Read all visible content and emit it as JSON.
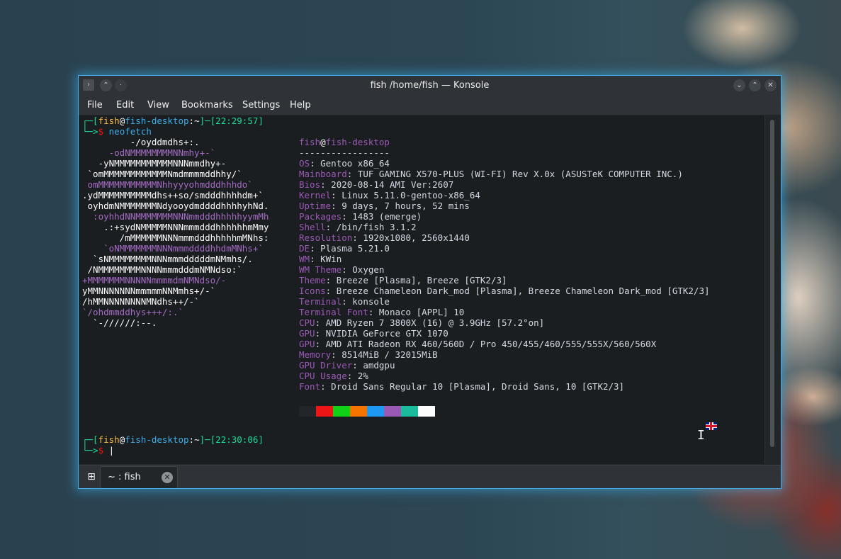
{
  "window": {
    "title": "fish /home/fish — Konsole",
    "buttons": {
      "minimize": "⌄",
      "maximize": "⌃",
      "close": "✕"
    }
  },
  "menu": [
    "File",
    "Edit",
    "View",
    "Bookmarks",
    "Settings",
    "Help"
  ],
  "tab": {
    "label": "~ : fish"
  },
  "colors": {
    "accent": "#3daee9",
    "prompt_green": "#1cdc9a",
    "purple": "#9b59b6"
  },
  "prompt1": {
    "user": "fish",
    "at": "@",
    "host": "fish-desktop",
    "dir": "~",
    "time": "22:29:57",
    "command": "neofetch"
  },
  "prompt2": {
    "user": "fish",
    "at": "@",
    "host": "fish-desktop",
    "dir": "~",
    "time": "22:30:06"
  },
  "logo": [
    "         -/oyddmdhs+:.",
    "     -odNMMMMMMMMNNmhy+-`",
    "   -yNMMMMMMMMMMMNNNmmdhy+-",
    " `omMMMMMMMMMMMMNmdmmmmddhhy/`",
    " omMMMMMMMMMMMNhhyyyohmdddhhhdo`",
    ".ydMMMMMMMMMMdhs++so/smdddhhhhdm+`",
    " oyhdmNMMMMMMMNdyooydmddddhhhhyhNd.",
    "  :oyhhdNNMMMMMMMNNNmmdddhhhhhyymMh",
    "    .:+sydNMMMMMNNNmmmdddhhhhhhmMmy",
    "       /mMMMMMMNNNmmmdddhhhhhmMNhs:",
    "    `oNMMMMMMMNNNmmmddddhhdmMNhs+`",
    "  `sNMMMMMMMMNNNmmmdddddmNMmhs/.",
    " /NMMMMMMMMNNNNmmmdddmNMNdso:`",
    "+MMMMMMMNNNNNmmmmdmNMNdso/-",
    "yMMNNNNNNNmmmmmNNMmhs+/-`",
    "/hMMNNNNNNNNMNdhs++/-`",
    "`/ohdmmddhys+++/:.`",
    "  `-//////:--."
  ],
  "info_header": {
    "user": "fish",
    "at": "@",
    "host": "fish-desktop",
    "separator": "-----------------"
  },
  "info": [
    {
      "key": "OS",
      "value": "Gentoo x86_64"
    },
    {
      "key": "Mainboard",
      "value": "TUF GAMING X570-PLUS (WI-FI) Rev X.0x (ASUSTeK COMPUTER INC.)"
    },
    {
      "key": "Bios",
      "value": "2020-08-14 AMI Ver:2607"
    },
    {
      "key": "Kernel",
      "value": "Linux 5.11.0-gentoo-x86_64"
    },
    {
      "key": "Uptime",
      "value": "9 days, 7 hours, 52 mins"
    },
    {
      "key": "Packages",
      "value": "1483 (emerge)"
    },
    {
      "key": "Shell",
      "value": "/bin/fish 3.1.2"
    },
    {
      "key": "Resolution",
      "value": "1920x1080, 2560x1440"
    },
    {
      "key": "DE",
      "value": "Plasma 5.21.0"
    },
    {
      "key": "WM",
      "value": "KWin"
    },
    {
      "key": "WM Theme",
      "value": "Oxygen"
    },
    {
      "key": "Theme",
      "value": "Breeze [Plasma], Breeze [GTK2/3]"
    },
    {
      "key": "Icons",
      "value": "Breeze Chameleon Dark_mod [Plasma], Breeze Chameleon Dark_mod [GTK2/3]"
    },
    {
      "key": "Terminal",
      "value": "konsole"
    },
    {
      "key": "Terminal Font",
      "value": "Monaco [APPL] 10"
    },
    {
      "key": "CPU",
      "value": "AMD Ryzen 7 3800X (16) @ 3.9GHz [57.2°on]"
    },
    {
      "key": "GPU",
      "value": "NVIDIA GeForce GTX 1070"
    },
    {
      "key": "GPU",
      "value": "AMD ATI Radeon RX 460/560D / Pro 450/455/460/555/555X/560/560X"
    },
    {
      "key": "Memory",
      "value": "8514MiB / 32015MiB"
    },
    {
      "key": "GPU Driver",
      "value": "amdgpu"
    },
    {
      "key": "CPU Usage",
      "value": "2%"
    },
    {
      "key": "Font",
      "value": "Droid Sans Regular 10 [Plasma], Droid Sans, 10 [GTK2/3]"
    }
  ],
  "palette": [
    "#232629",
    "#ed1515",
    "#11d116",
    "#f67400",
    "#1d99f3",
    "#9b59b6",
    "#1abc9c",
    "#fcfcfc"
  ]
}
